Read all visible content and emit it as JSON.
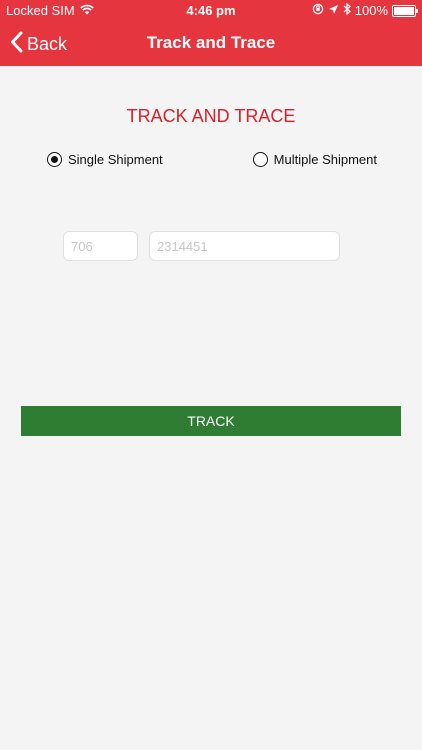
{
  "status_bar": {
    "carrier": "Locked SIM",
    "time": "4:46 pm",
    "battery": "100%"
  },
  "nav": {
    "back_label": "Back",
    "title": "Track and Trace"
  },
  "main": {
    "heading": "TRACK AND TRACE",
    "radio_options": [
      {
        "label": "Single Shipment",
        "selected": true
      },
      {
        "label": "Multiple Shipment",
        "selected": false
      }
    ],
    "inputs": {
      "prefix_placeholder": "706",
      "number_placeholder": "2314451"
    },
    "track_button_label": "TRACK"
  },
  "colors": {
    "header_red": "#e5353f",
    "heading_red": "#d6222c",
    "button_green": "#2e7d32",
    "background": "#f4f4f4"
  }
}
